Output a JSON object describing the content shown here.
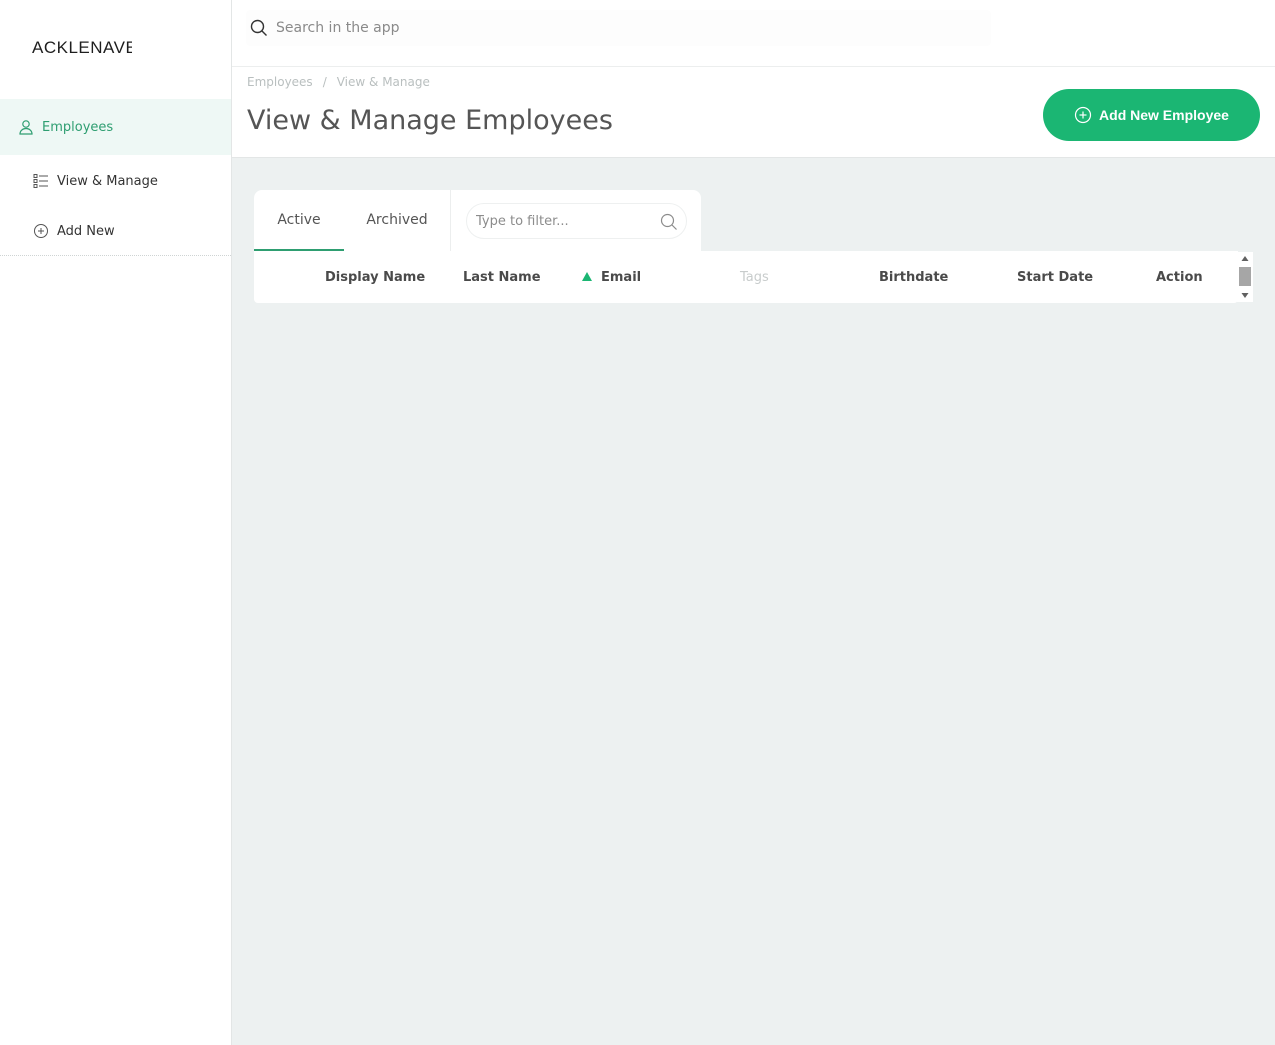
{
  "brand": {
    "logo_text": "ACKLENAVENUE"
  },
  "search": {
    "placeholder": "Search in the app"
  },
  "sidebar": {
    "items": [
      {
        "label": "Employees",
        "icon": "user-icon",
        "active": true
      },
      {
        "label": "View & Manage",
        "icon": "list-icon"
      },
      {
        "label": "Add New",
        "icon": "plus-circle-icon"
      }
    ]
  },
  "breadcrumb": {
    "items": [
      "Employees",
      "/",
      "View & Manage"
    ]
  },
  "page": {
    "title": "View & Manage Employees"
  },
  "actions": {
    "add_employee_label": "Add New Employee"
  },
  "tabs": [
    {
      "label": "Active",
      "active": true
    },
    {
      "label": "Archived",
      "active": false
    }
  ],
  "filter": {
    "placeholder": "Type to filter..."
  },
  "table": {
    "columns": [
      "Display Name",
      "Last Name",
      "Email",
      "Tags",
      "Birthdate",
      "Start Date",
      "Action"
    ],
    "sorted_by": "Email",
    "sort_direction": "ascending",
    "disabled_columns": [
      "Tags"
    ],
    "rows": []
  },
  "colors": {
    "accent": "#1bb673",
    "accent_text": "#2e9e71",
    "content_bg": "#edf1f1"
  }
}
